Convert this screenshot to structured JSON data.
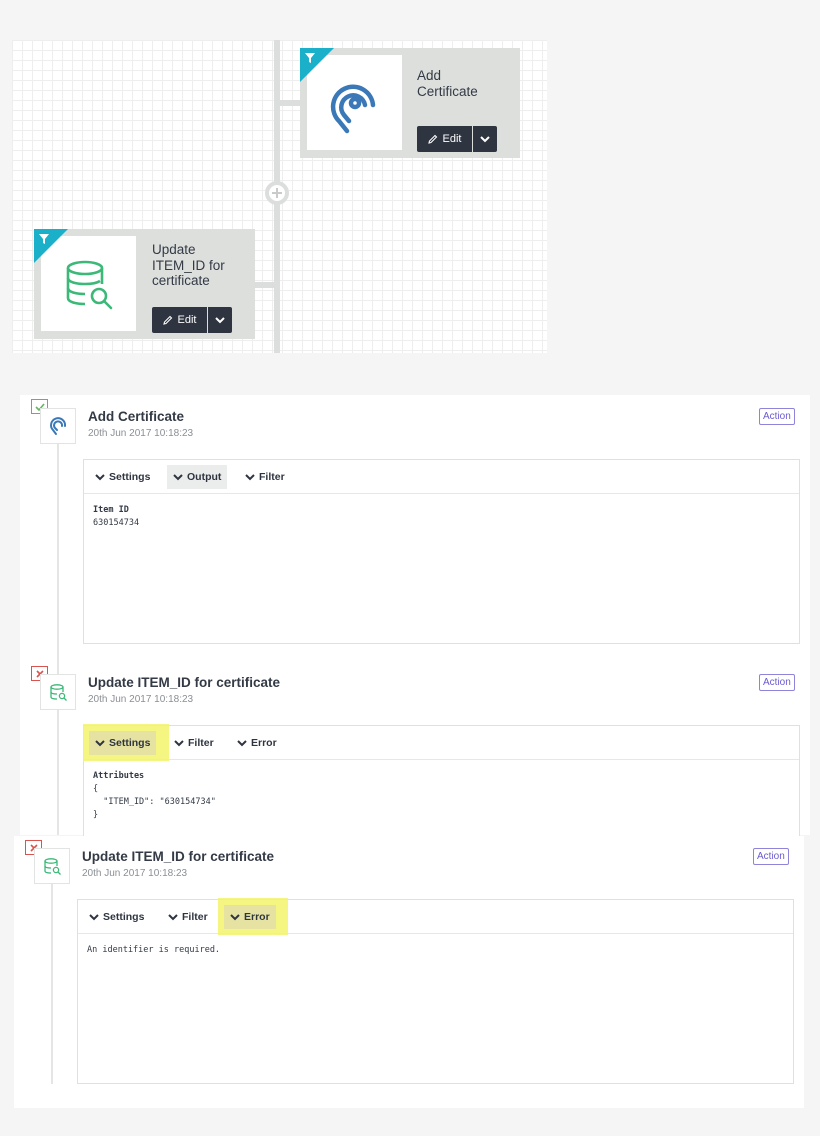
{
  "workflow": {
    "steps": [
      {
        "title_line1": "Add",
        "title_line2": "Certificate",
        "title_line3": "",
        "edit_label": "Edit",
        "icon": "pin-icon"
      },
      {
        "title_line1": "Update",
        "title_line2": "ITEM_ID for",
        "title_line3": "certificate",
        "edit_label": "Edit",
        "icon": "database-search-icon"
      }
    ]
  },
  "logs": [
    {
      "title": "Add Certificate",
      "timestamp": "20th Jun 2017 10:18:23",
      "badge": "Action",
      "status": "success",
      "tabs": [
        "Settings",
        "Output",
        "Filter"
      ],
      "active_tab": "Output",
      "content_label": "Item ID",
      "content_value": "630154734"
    },
    {
      "title": "Update ITEM_ID for certificate",
      "timestamp": "20th Jun 2017 10:18:23",
      "badge": "Action",
      "status": "error",
      "tabs": [
        "Settings",
        "Filter",
        "Error"
      ],
      "active_tab": "Settings",
      "content_label": "Attributes",
      "content_lines": [
        "{",
        "  \"ITEM_ID\": \"630154734\"",
        "}"
      ]
    },
    {
      "title": "Update ITEM_ID for certificate",
      "timestamp": "20th Jun 2017 10:18:23",
      "badge": "Action",
      "status": "error",
      "tabs": [
        "Settings",
        "Filter",
        "Error"
      ],
      "active_tab": "Error",
      "content_value": "An identifier is required."
    }
  ],
  "colors": {
    "accent_corner": "#1ab0c9",
    "edit_button": "#2e3440",
    "highlight": "#f3f36c",
    "badge": "#6a5bd0",
    "success": "#5fb85f",
    "error": "#d9534f"
  }
}
